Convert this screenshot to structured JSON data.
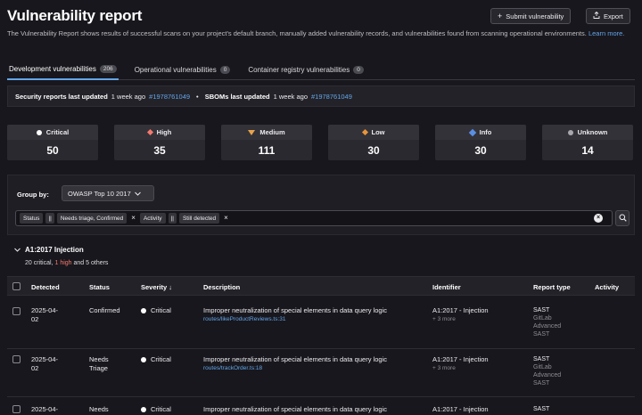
{
  "header": {
    "title": "Vulnerability report",
    "submit_label": "Submit vulnerability",
    "export_label": "Export",
    "description": "The Vulnerability Report shows results of successful scans on your project's default branch, manually added vulnerability records, and vulnerabilities found from scanning operational environments.",
    "learn_more": "Learn more."
  },
  "tabs": [
    {
      "label": "Development vulnerabilities",
      "count": "206",
      "active": true
    },
    {
      "label": "Operational vulnerabilities",
      "count": "0",
      "active": false
    },
    {
      "label": "Container registry vulnerabilities",
      "count": "0",
      "active": false
    }
  ],
  "updated": {
    "security_label": "Security reports last updated",
    "security_when": "1 week ago",
    "security_pipeline": "#1978761049",
    "separator": "•",
    "sbom_label": "SBOMs last updated",
    "sbom_when": "1 week ago",
    "sbom_pipeline": "#1978761049"
  },
  "severity_counts": [
    {
      "label": "Critical",
      "value": "50",
      "icon": "critical-icon"
    },
    {
      "label": "High",
      "value": "35",
      "icon": "high-icon"
    },
    {
      "label": "Medium",
      "value": "111",
      "icon": "medium-icon"
    },
    {
      "label": "Low",
      "value": "30",
      "icon": "low-icon"
    },
    {
      "label": "Info",
      "value": "30",
      "icon": "info-icon"
    },
    {
      "label": "Unknown",
      "value": "14",
      "icon": "unknown-icon"
    }
  ],
  "filters": {
    "group_by_label": "Group by:",
    "group_by_value": "OWASP Top 10 2017",
    "tokens": [
      {
        "field": "Status",
        "operator": "||",
        "value": "Needs triage, Confirmed"
      },
      {
        "field": "Activity",
        "operator": "||",
        "value": "Still detected"
      }
    ]
  },
  "group": {
    "title": "A1:2017 Injection",
    "summary_critical": "20 critical",
    "summary_sep": ",",
    "summary_high": "1 high",
    "summary_rest": "and 5 others"
  },
  "table": {
    "columns": [
      "Detected",
      "Status",
      "Severity",
      "Description",
      "Identifier",
      "Report type",
      "Activity"
    ],
    "sort_indicator": "↓",
    "rows": [
      {
        "detected_1": "2025-04-",
        "detected_2": "02",
        "status_1": "Confirmed",
        "status_2": "",
        "severity": "Critical",
        "description": "Improper neutralization of special elements in data query logic",
        "path": "routes/likeProductReviews.ts:31",
        "identifier": "A1:2017 - Injection",
        "more": "+ 3 more",
        "report_type": "SAST",
        "scanner_1": "GitLab",
        "scanner_2": "Advanced",
        "scanner_3": "SAST"
      },
      {
        "detected_1": "2025-04-",
        "detected_2": "02",
        "status_1": "Needs",
        "status_2": "Triage",
        "severity": "Critical",
        "description": "Improper neutralization of special elements in data query logic",
        "path": "routes/trackOrder.ts:18",
        "identifier": "A1:2017 - Injection",
        "more": "+ 3 more",
        "report_type": "SAST",
        "scanner_1": "GitLab",
        "scanner_2": "Advanced",
        "scanner_3": "SAST"
      },
      {
        "detected_1": "2025-04-",
        "detected_2": "",
        "status_1": "Needs",
        "status_2": "",
        "severity": "Critical",
        "description": "Improper neutralization of special elements in data query logic",
        "path": "",
        "identifier": "A1:2017 - Injection",
        "more": "",
        "report_type": "SAST",
        "scanner_1": "",
        "scanner_2": "",
        "scanner_3": ""
      }
    ]
  }
}
